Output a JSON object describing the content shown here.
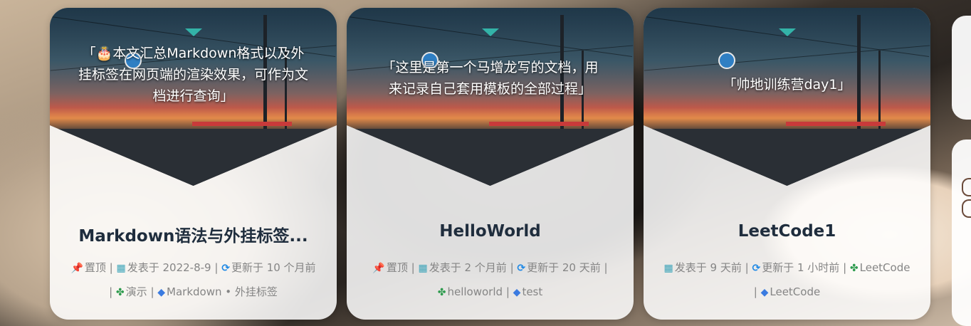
{
  "posts": [
    {
      "excerpt_line1": "「🎂本文汇总Markdown格式以及外",
      "excerpt_line2": "挂标签在网页端的渲染效果，可作为文",
      "excerpt_line3": "档进行查询」",
      "title": "Markdown语法与外挂标签...",
      "pinned": "置顶",
      "published": "发表于 2022-8-9",
      "updated": "更新于 10 个月前",
      "category": "演示",
      "tags": "Markdown • 外挂标签"
    },
    {
      "excerpt_line1": "「这里是第一个马增龙写的文档，用",
      "excerpt_line2": "来记录自己套用模板的全部过程」",
      "title": "HelloWorld",
      "pinned": "置顶",
      "published": "发表于 2 个月前",
      "updated": "更新于 20 天前",
      "category": "helloworld",
      "tags": "test"
    },
    {
      "excerpt_line1": "「帅地训练营day1」",
      "title": "LeetCode1",
      "published": "发表于 9 天前",
      "updated": "更新于 1 小时前",
      "category": "LeetCode",
      "tags": "LeetCode"
    }
  ],
  "icons": {
    "pin": "pushpin-icon",
    "calendar": "calendar-icon",
    "sync": "sync-icon",
    "category": "clover-icon",
    "tag": "tag-icon"
  }
}
